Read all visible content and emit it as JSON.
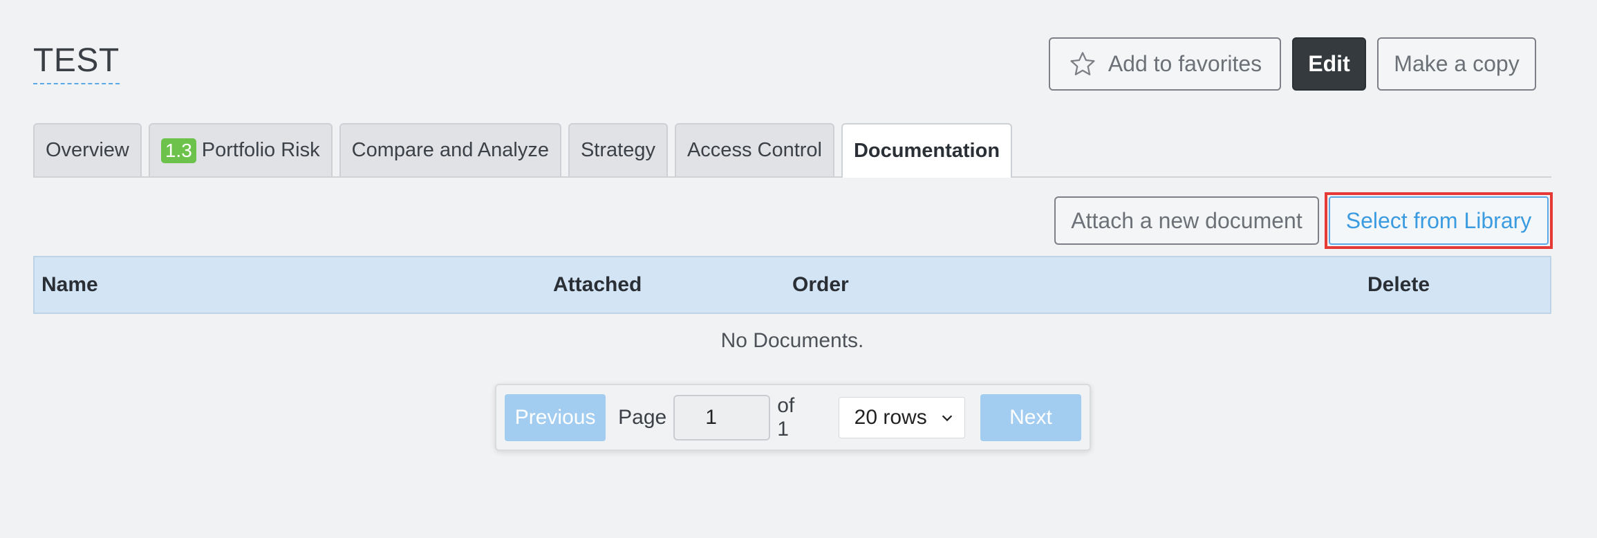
{
  "header": {
    "title": "TEST",
    "favorite_label": "Add to favorites",
    "edit_label": "Edit",
    "copy_label": "Make a copy"
  },
  "tabs": [
    {
      "label": "Overview"
    },
    {
      "badge": "1.3",
      "label": "Portfolio Risk"
    },
    {
      "label": "Compare and Analyze"
    },
    {
      "label": "Strategy"
    },
    {
      "label": "Access Control"
    },
    {
      "label": "Documentation",
      "active": true
    }
  ],
  "documents": {
    "attach_label": "Attach a new document",
    "library_label": "Select from Library",
    "columns": [
      "Name",
      "Attached",
      "Order",
      "Delete"
    ],
    "empty_message": "No Documents."
  },
  "pagination": {
    "previous_label": "Previous",
    "page_label": "Page",
    "current_page": "1",
    "of_label": "of 1",
    "rows_selected": "20 rows",
    "next_label": "Next"
  },
  "colors": {
    "accent": "#3b9be0",
    "highlight_box": "#e53935",
    "badge": "#6cc24a",
    "header_row": "#d3e4f5",
    "pager_button": "#a3cdf0",
    "edit_button": "#343a3e"
  },
  "icons": {
    "favorite": "star-outline-icon",
    "rows_dropdown": "chevron-down-icon"
  }
}
